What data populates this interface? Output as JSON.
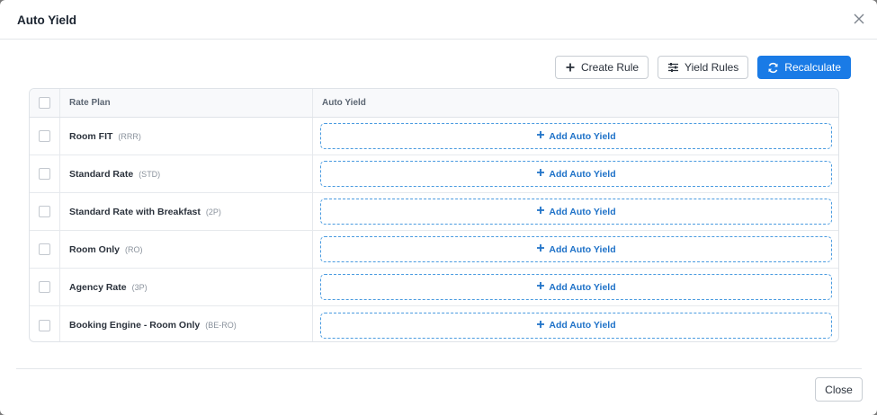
{
  "modal": {
    "title": "Auto Yield",
    "close_button_label": "Close"
  },
  "toolbar": {
    "create_rule_label": "Create Rule",
    "yield_rules_label": "Yield Rules",
    "recalculate_label": "Recalculate"
  },
  "table": {
    "columns": [
      "Rate Plan",
      "Auto Yield"
    ],
    "add_label": "Add Auto Yield",
    "rows": [
      {
        "name": "Room FIT",
        "code": "(RRR)"
      },
      {
        "name": "Standard Rate",
        "code": "(STD)"
      },
      {
        "name": "Standard Rate with Breakfast",
        "code": "(2P)"
      },
      {
        "name": "Room Only",
        "code": "(RO)"
      },
      {
        "name": "Agency Rate",
        "code": "(3P)"
      },
      {
        "name": "Booking Engine - Room Only",
        "code": "(BE-RO)"
      }
    ]
  },
  "colors": {
    "primary": "#1a7be6",
    "dashed_border": "#4a9be0"
  }
}
